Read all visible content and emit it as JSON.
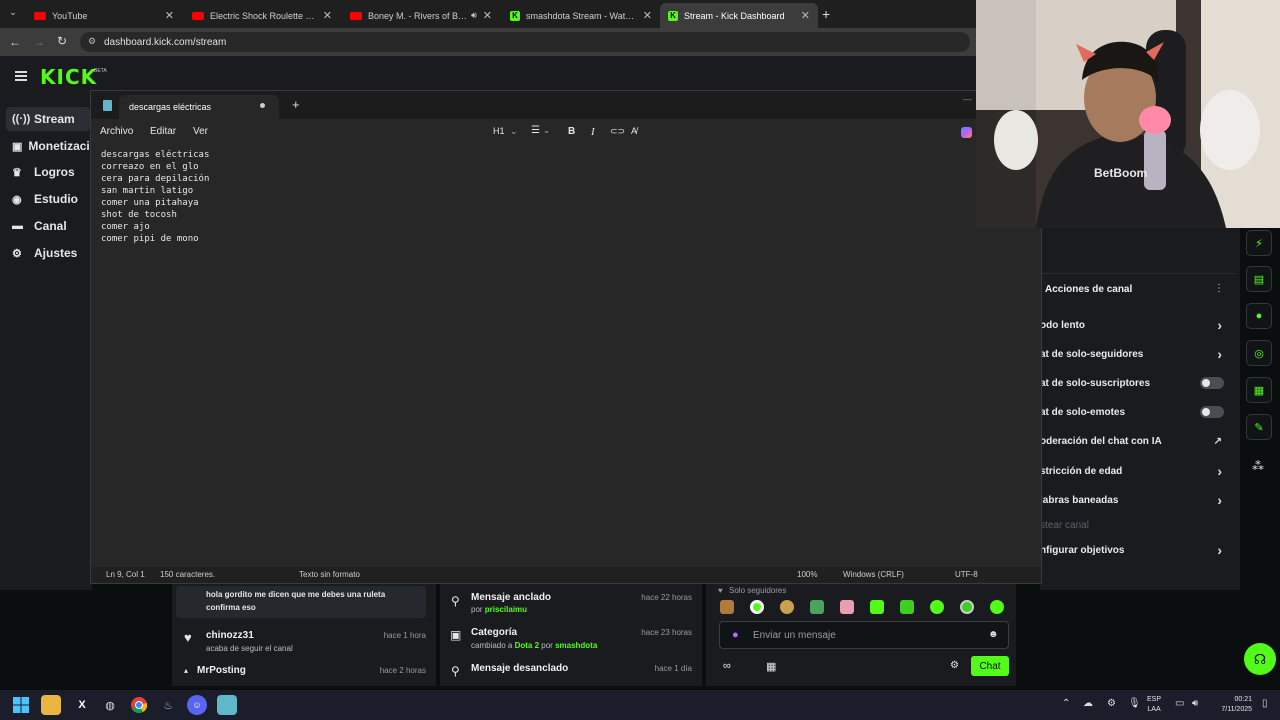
{
  "browser": {
    "tabs": [
      {
        "title": "YouTube",
        "icon": "youtube-icon"
      },
      {
        "title": "Electric Shock Roulette Game fo",
        "icon": "youtube-icon"
      },
      {
        "title": "Boney M. - Rivers of Babylon",
        "icon": "youtube-icon"
      },
      {
        "title": "smashdota Stream - Watch Live",
        "icon": "kick-icon"
      },
      {
        "title": "Stream - Kick Dashboard",
        "icon": "kick-icon"
      }
    ],
    "url": "dashboard.kick.com/stream"
  },
  "kick": {
    "logo": "KICK",
    "beta": "BETA",
    "accent": "#53fc18",
    "sidebar": [
      {
        "label": "Stream",
        "icon": "broadcast-icon"
      },
      {
        "label": "Monetización",
        "icon": "money-icon"
      },
      {
        "label": "Logros",
        "icon": "trophy-icon"
      },
      {
        "label": "Estudio",
        "icon": "studio-icon"
      },
      {
        "label": "Canal",
        "icon": "channel-icon"
      },
      {
        "label": "Ajustes",
        "icon": "gear-icon"
      }
    ],
    "actions": {
      "title": "Acciones de canal",
      "items": [
        {
          "label": "odo lento",
          "control": "chevron"
        },
        {
          "label": "at de solo-seguidores",
          "control": "chevron"
        },
        {
          "label": "at de solo-suscriptores",
          "control": "toggle"
        },
        {
          "label": "at de solo-emotes",
          "control": "toggle"
        },
        {
          "label": "oderación del chat con IA",
          "control": "external"
        },
        {
          "label": "stricción de edad",
          "control": "chevron"
        },
        {
          "label": "labras baneadas",
          "control": "chevron"
        },
        {
          "label": "stear canal",
          "control": "none",
          "disabled": true
        },
        {
          "label": "nfigurar objetivos",
          "control": "chevron"
        }
      ]
    },
    "activity": [
      {
        "user": "",
        "text": "hola gordito me dicen que me debes una ruleta confirma eso",
        "time": ""
      },
      {
        "user": "chinozz31",
        "text": "acaba de seguir el canal",
        "time": "hace 1 hora"
      },
      {
        "user": "MrPosting",
        "text": "",
        "time": "hace 2 horas"
      }
    ],
    "events": [
      {
        "title": "Mensaje anclado",
        "sub_prefix": "por ",
        "sub_green": "priscilaimu",
        "time": "hace 22 horas"
      },
      {
        "title": "Categoría",
        "sub_prefix": "cambiado a ",
        "sub_green": "Dota 2",
        "sub_mid": " por ",
        "sub_green2": "smashdota",
        "time": "hace 23 horas"
      },
      {
        "title": "Mensaje desanclado",
        "sub_prefix": "",
        "sub_green": "",
        "time": "hace 1 día"
      }
    ],
    "chat": {
      "mode": "Solo seguidores",
      "placeholder": "Enviar un mensaje",
      "send_label": "Chat"
    }
  },
  "notepad": {
    "tab_title": "descargas eléctricas",
    "menu": [
      "Archivo",
      "Editar",
      "Ver"
    ],
    "heading_select": "H1",
    "lines": [
      "descargas eléctricas",
      "correazo en el glo",
      "cera para depilación",
      "san martin latigo",
      "comer una pitahaya",
      "shot de tocosh",
      "comer ajo",
      "comer pipi de mono"
    ],
    "status": {
      "position": "Ln 9, Col 1",
      "chars": "150 caracteres.",
      "format": "Texto sin formato",
      "zoom": "100%",
      "line_ending": "Windows (CRLF)",
      "encoding": "UTF-8"
    }
  },
  "webcam": {
    "shirt_text": "BetBoom"
  },
  "taskbar": {
    "lang": "ESP",
    "lang_sub": "LAA",
    "time": "00:21",
    "date": "7/11/2025"
  }
}
